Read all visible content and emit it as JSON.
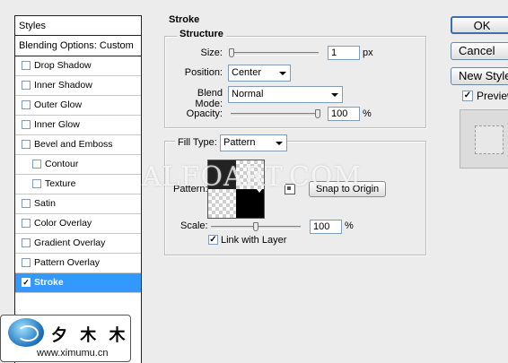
{
  "styles_panel": {
    "header": "Styles",
    "blending_options": "Blending Options: Custom",
    "items": [
      {
        "label": "Drop Shadow",
        "checked": false,
        "indent": false,
        "active": false
      },
      {
        "label": "Inner Shadow",
        "checked": false,
        "indent": false,
        "active": false
      },
      {
        "label": "Outer Glow",
        "checked": false,
        "indent": false,
        "active": false
      },
      {
        "label": "Inner Glow",
        "checked": false,
        "indent": false,
        "active": false
      },
      {
        "label": "Bevel and Emboss",
        "checked": false,
        "indent": false,
        "active": false
      },
      {
        "label": "Contour",
        "checked": false,
        "indent": true,
        "active": false
      },
      {
        "label": "Texture",
        "checked": false,
        "indent": true,
        "active": false
      },
      {
        "label": "Satin",
        "checked": false,
        "indent": false,
        "active": false
      },
      {
        "label": "Color Overlay",
        "checked": false,
        "indent": false,
        "active": false
      },
      {
        "label": "Gradient Overlay",
        "checked": false,
        "indent": false,
        "active": false
      },
      {
        "label": "Pattern Overlay",
        "checked": false,
        "indent": false,
        "active": false
      },
      {
        "label": "Stroke",
        "checked": true,
        "indent": false,
        "active": true
      }
    ]
  },
  "stroke": {
    "title": "Stroke",
    "structure": {
      "title": "Structure",
      "size_label": "Size:",
      "size_value": "1",
      "size_unit": "px",
      "size_level": 0.0,
      "position_label": "Position:",
      "position_value": "Center",
      "blend_mode_label": "Blend Mode:",
      "blend_mode_value": "Normal",
      "opacity_label": "Opacity:",
      "opacity_value": "100",
      "opacity_unit": "%",
      "opacity_level": 1.0
    },
    "fill": {
      "fill_type_label": "Fill Type:",
      "fill_type_value": "Pattern",
      "pattern_label": "Pattern:",
      "snap_to_origin": "Snap to Origin",
      "scale_label": "Scale:",
      "scale_value": "100",
      "scale_unit": "%",
      "scale_level": 0.5,
      "link_with_layer_label": "Link with Layer",
      "link_with_layer_checked": true
    }
  },
  "buttons": {
    "ok": "OK",
    "cancel": "Cancel",
    "new_style": "New Style",
    "preview_label": "Preview",
    "preview_checked": true
  },
  "watermark": "ALFOART.COM",
  "logo": {
    "chinese": "夕 木 木",
    "url": "www.ximumu.cn"
  },
  "colors": {
    "selection": "#3399ff",
    "panel_bg": "#ececec",
    "field_border": "#7f9db9"
  }
}
